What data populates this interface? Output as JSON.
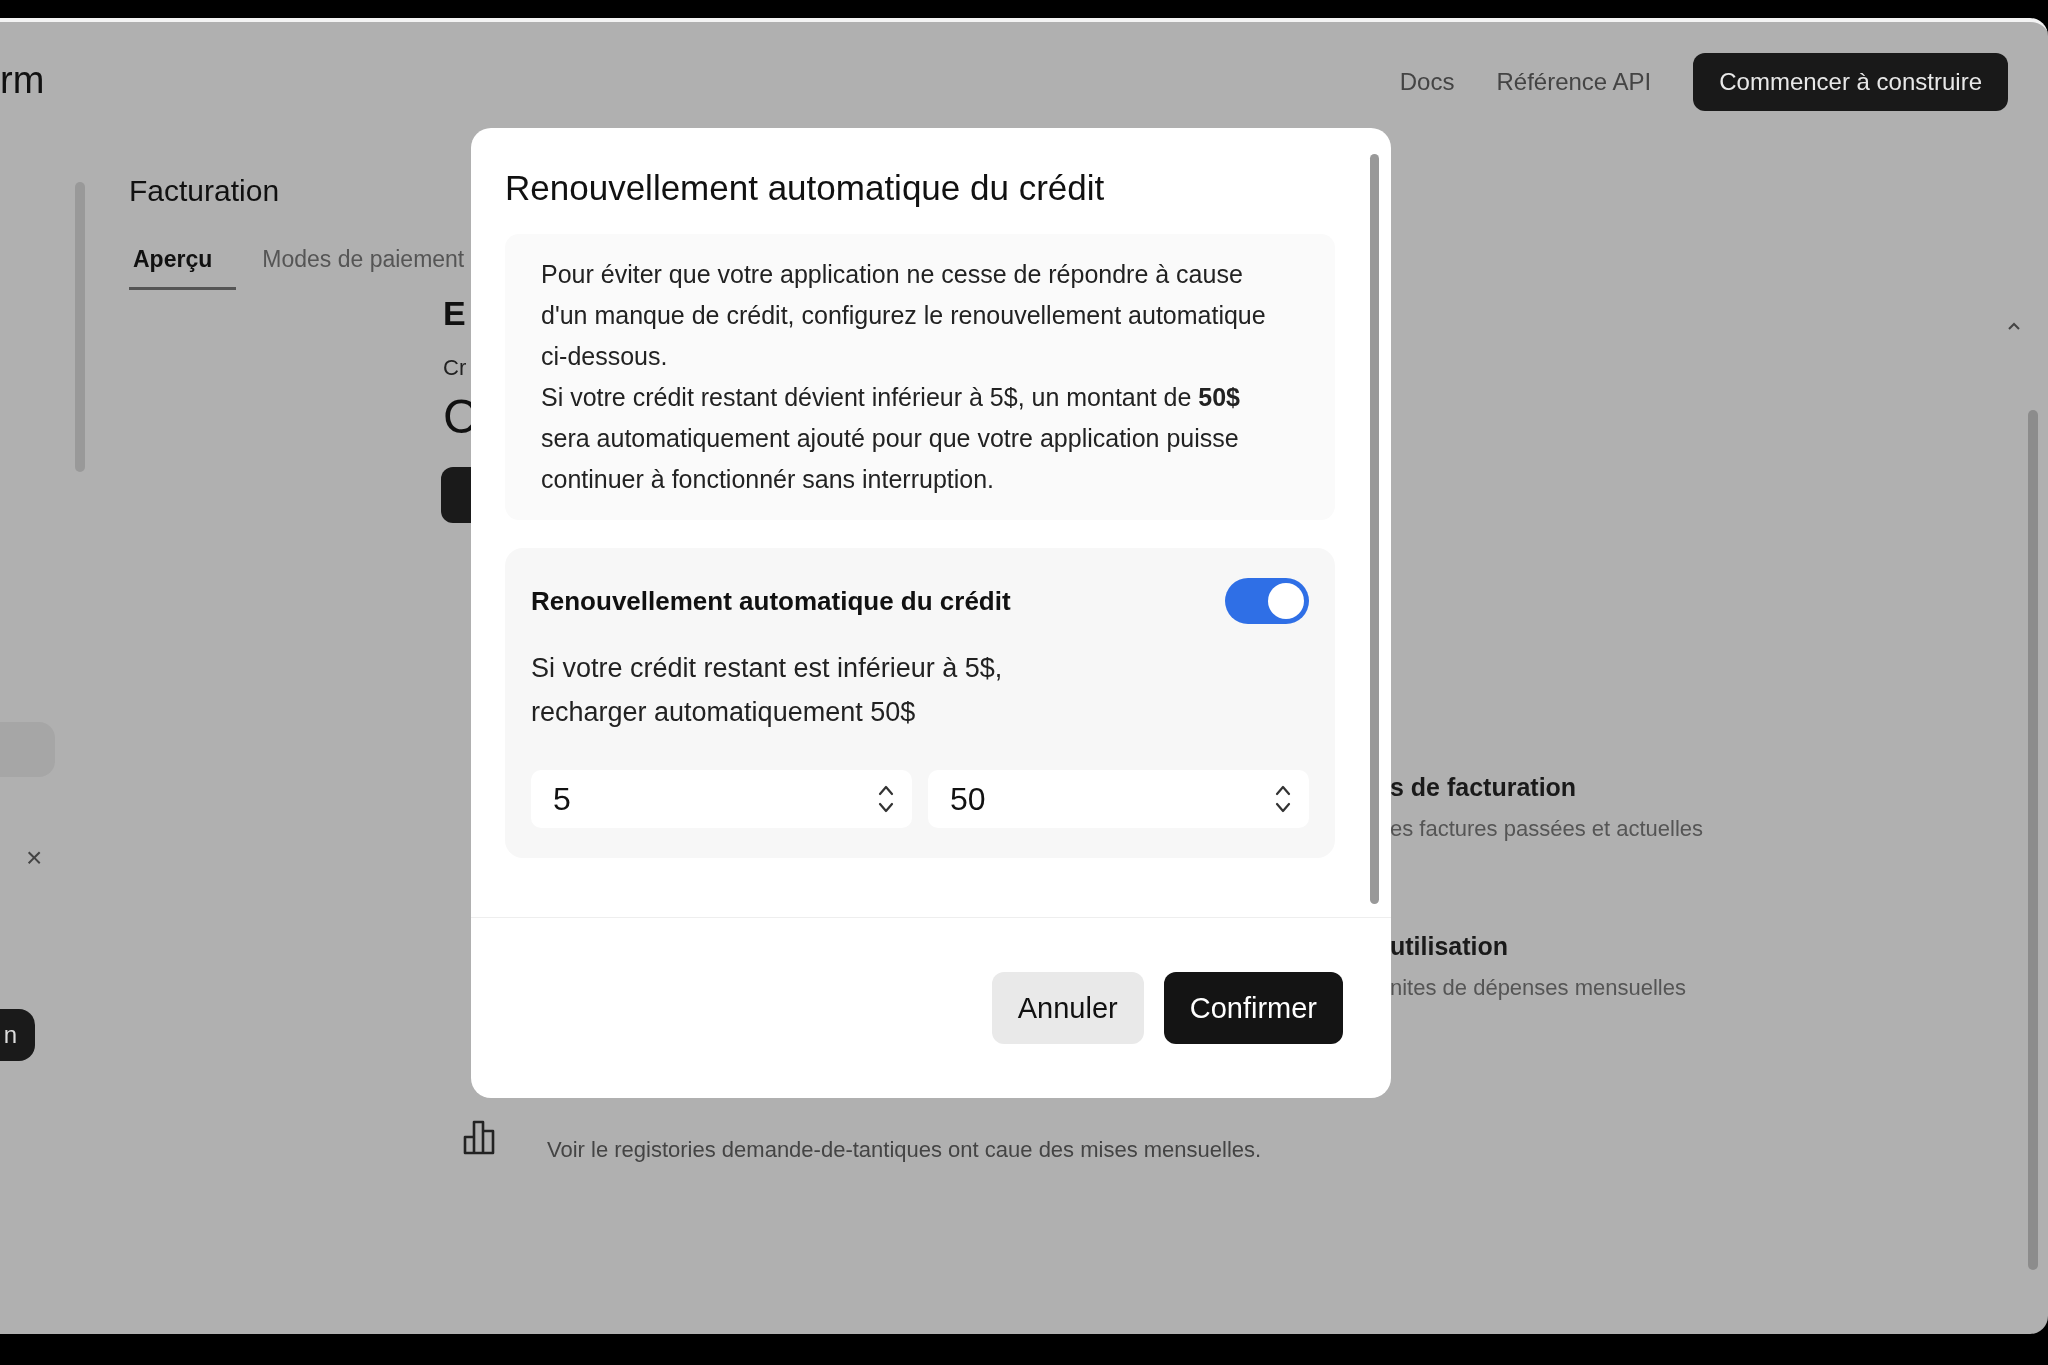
{
  "header": {
    "logo_fragment": "rm",
    "links": [
      "Docs",
      "Référence API"
    ],
    "cta": "Commencer à construire"
  },
  "sidebar": {
    "close_glyph": "×",
    "button_fragment": "n"
  },
  "page": {
    "title": "Facturation",
    "tabs": [
      {
        "label": "Aperçu",
        "selected": true
      },
      {
        "label": "Modes de paiement",
        "selected": false
      }
    ],
    "section_fragment": "E",
    "label_fragment": "Cr",
    "value_fragment": "C",
    "rows": [
      {
        "title": "s de facturation",
        "description": "es factures passées et actuelles"
      },
      {
        "title": "utilisation",
        "description": "nites de dépenses mensuelles"
      }
    ],
    "footer_note": "Voir le registories demande-de-tantiques ont caue des mises mensuelles."
  },
  "dialog": {
    "title": "Renouvellement automatique du crédit",
    "info": [
      "Pour éviter que votre application ne cesse de répondre à cause d'un manque de crédit, configurez le renouvellement automatique ci-dessous.",
      "Si votre crédit restant dévient inférieur à 5$, un montant de **50$** sera automatiquement ajouté pour que votre application puisse continuer à fonctionnér sans interruption."
    ],
    "auto_renew": {
      "label": "Renouvellement automatique du crédit",
      "on": true,
      "description": [
        "Si votre crédit restant est inférieur à 5$,",
        "recharger automatiquement 50$"
      ],
      "fields": [
        {
          "value": "5"
        },
        {
          "value": "50"
        }
      ]
    },
    "buttons": [
      {
        "label": "Annuler",
        "kind": "secondary"
      },
      {
        "label": "Confirmer",
        "kind": "primary"
      }
    ]
  }
}
